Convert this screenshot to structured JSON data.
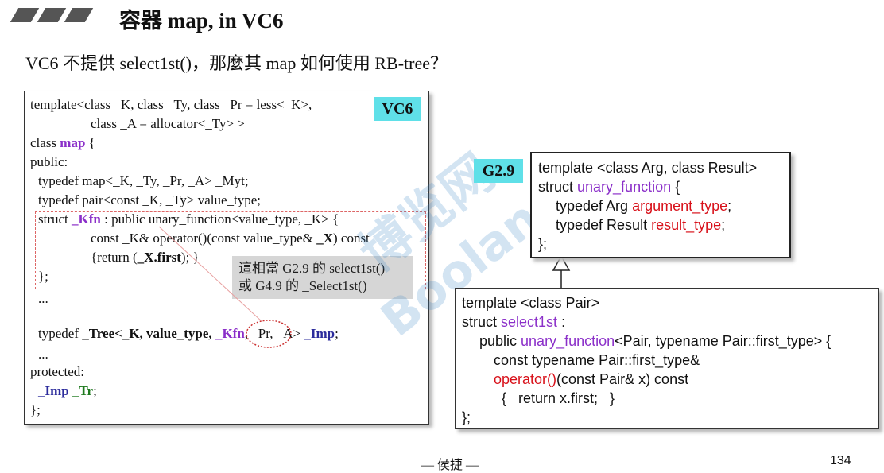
{
  "header": {
    "title": "容器 map, in VC6"
  },
  "subtitle": "VC6 不提供 select1st()，那麼其 map 如何使用 RB-tree？",
  "left_code": {
    "badge": "VC6",
    "l1": "template<class _K, class _Ty, class _Pr = less<_K>,",
    "l2": "class _A = allocator<_Ty> >",
    "l3a": "class ",
    "l3b": "map",
    "l3c": " {",
    "l4": "public:",
    "l5": "typedef map<_K, _Ty, _Pr, _A> _Myt;",
    "l6": "typedef pair<const _K, _Ty> value_type;",
    "l7a": "struct ",
    "l7b": "_Kfn",
    "l7c": " : public unary_function<value_type, _K> {",
    "l8a": "const _K& operator()(const value_type& ",
    "l8b": "_X",
    "l8c": ") const",
    "l9a": "{return (",
    "l9b": "_X.first",
    "l9c": "); }",
    "l10": "};",
    "l11": "...",
    "l12a": "typedef ",
    "l12b": "_Tree<_K, value_type, ",
    "l12c": "_Kfn",
    "l12d": ", _Pr, _A> ",
    "l12e": "_Imp",
    "l12f": ";",
    "l13": "...",
    "l14": "protected:",
    "l15a": "_Imp",
    "l15b": " _Tr",
    "l15c": ";",
    "l16": "};"
  },
  "callout": {
    "line1": "這相當 G2.9 的 select1st()",
    "line2": "或 G4.9 的 _Select1st()"
  },
  "unary_box": {
    "badge": "G2.9",
    "l1": "template <class Arg, class Result>",
    "l2a": "struct ",
    "l2b": "unary_function",
    "l2c": " {",
    "l3a": "typedef Arg ",
    "l3b": "argument_type",
    "l3c": ";",
    "l4a": "typedef Result ",
    "l4b": "result_type",
    "l4c": ";",
    "l5": "};"
  },
  "select_box": {
    "l1": "template <class Pair>",
    "l2a": "struct ",
    "l2b": "select1st",
    "l2c": " :",
    "l3a": "public ",
    "l3b": "unary_function",
    "l3c": "<Pair, typename Pair::first_type> {",
    "l4": "const typename Pair::first_type&",
    "l5a": "operator()",
    "l5b": "(const Pair& x) const",
    "l6": "{   return x.first;   }",
    "l7": "};"
  },
  "footer": {
    "author": "— 侯捷 —",
    "page": "134"
  },
  "watermark": {
    "text1": "博览网",
    "text2": "Boolan"
  },
  "colors": {
    "accent_cyan": "#5fe0e8",
    "purple": "#8b2fc9",
    "red": "#d8111a",
    "green": "#1f7a1f",
    "blue": "#2c2c9c"
  }
}
